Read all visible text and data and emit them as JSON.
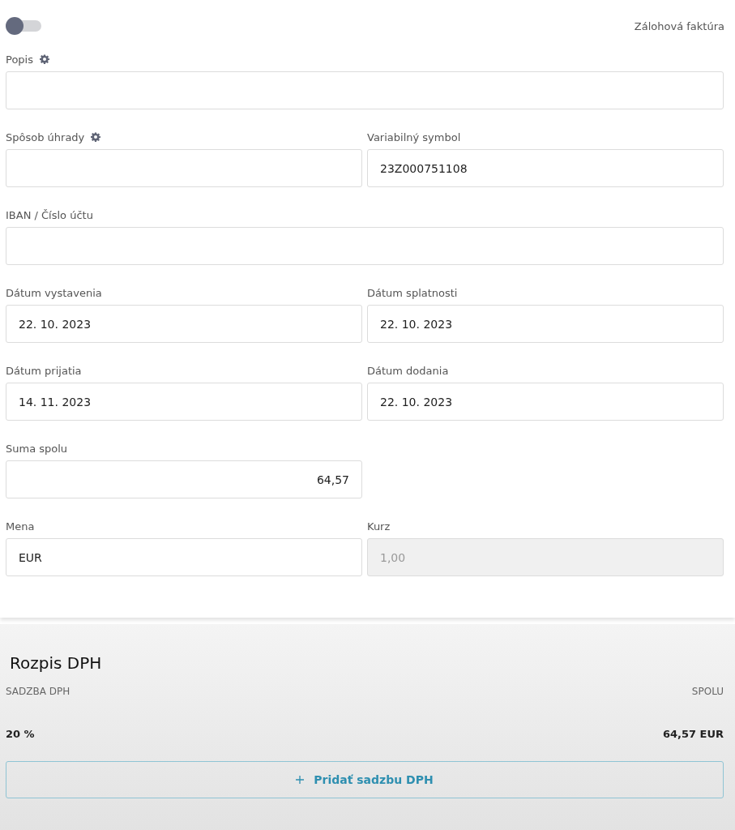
{
  "toggle": {
    "on": false,
    "label": "Zálohová faktúra"
  },
  "form_rows": [
    {
      "fields": [
        {
          "label": "Popis",
          "settings": true,
          "disabled": false,
          "kind": "text"
        }
      ]
    },
    {
      "fields": [
        {
          "label": "Spôsob úhrady",
          "settings": true,
          "disabled": false,
          "kind": "text"
        },
        {
          "label": "Variabilný symbol",
          "settings": false,
          "value": "23Z000751108",
          "disabled": false,
          "kind": "text"
        }
      ]
    },
    {
      "fields": [
        {
          "label": "IBAN / Číslo účtu",
          "settings": false,
          "disabled": false,
          "kind": "text"
        }
      ]
    },
    {
      "fields": [
        {
          "label": "Dátum vystavenia",
          "settings": false,
          "value": "22. 10. 2023",
          "disabled": false,
          "kind": "text"
        },
        {
          "label": "Dátum splatnosti",
          "settings": false,
          "value": "22. 10. 2023",
          "disabled": false,
          "kind": "text"
        }
      ]
    },
    {
      "fields": [
        {
          "label": "Dátum prijatia",
          "settings": false,
          "value": "14. 11. 2023",
          "disabled": false,
          "kind": "text"
        },
        {
          "label": "Dátum dodania",
          "settings": false,
          "value": "22. 10. 2023",
          "disabled": false,
          "kind": "text"
        }
      ]
    },
    {
      "fields": [
        {
          "label": "Suma spolu",
          "settings": false,
          "value": "64,57",
          "disabled": false,
          "kind": "amount"
        }
      ]
    },
    {
      "fields": [
        {
          "label": "Mena",
          "settings": false,
          "value": "EUR",
          "disabled": false,
          "kind": "text"
        },
        {
          "label": "Kurz",
          "settings": false,
          "value": "1,00",
          "disabled": true,
          "kind": "text"
        }
      ]
    }
  ],
  "vat": {
    "title": "Rozpis DPH",
    "columns": [
      "SADZBA DPH",
      "SPOLU"
    ],
    "rows": [
      {
        "rate": "20 %",
        "total": "64,57 EUR"
      }
    ],
    "add_button": "Pridať sadzbu DPH"
  }
}
